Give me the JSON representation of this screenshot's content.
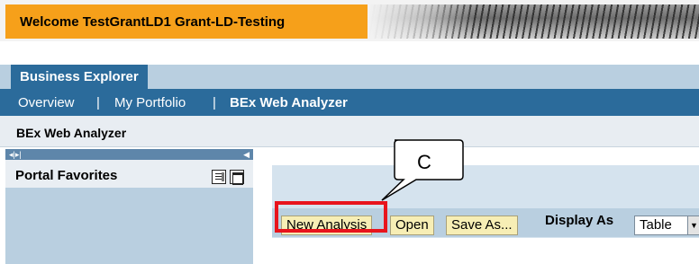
{
  "header": {
    "welcome_text": "Welcome TestGrantLD1 Grant-LD-Testing"
  },
  "tabs": [
    {
      "label": "Business Explorer",
      "active": true
    }
  ],
  "nav": {
    "items": [
      "Overview",
      "My Portfolio",
      "BEx Web Analyzer"
    ],
    "separator": "|",
    "active": "BEx Web Analyzer"
  },
  "page": {
    "title": "BEx Web Analyzer"
  },
  "portal_favorites": {
    "title": "Portal Favorites"
  },
  "toolbar": {
    "new_analysis": "New Analysis",
    "open": "Open",
    "save_as": "Save As...",
    "display_as_label": "Display As",
    "display_as_value": "Table"
  },
  "callout": {
    "label": "C"
  },
  "colors": {
    "welcome_bg": "#f6a01a",
    "tab_active": "#2b6b9b",
    "light_blue": "#b9cfe0",
    "button_bg": "#f7eeb5",
    "highlight": "#e8141c"
  },
  "icons": [
    "list-view-icon",
    "window-icon",
    "scroll-arrows-icon",
    "collapse-arrow-icon",
    "dropdown-arrow-icon"
  ]
}
